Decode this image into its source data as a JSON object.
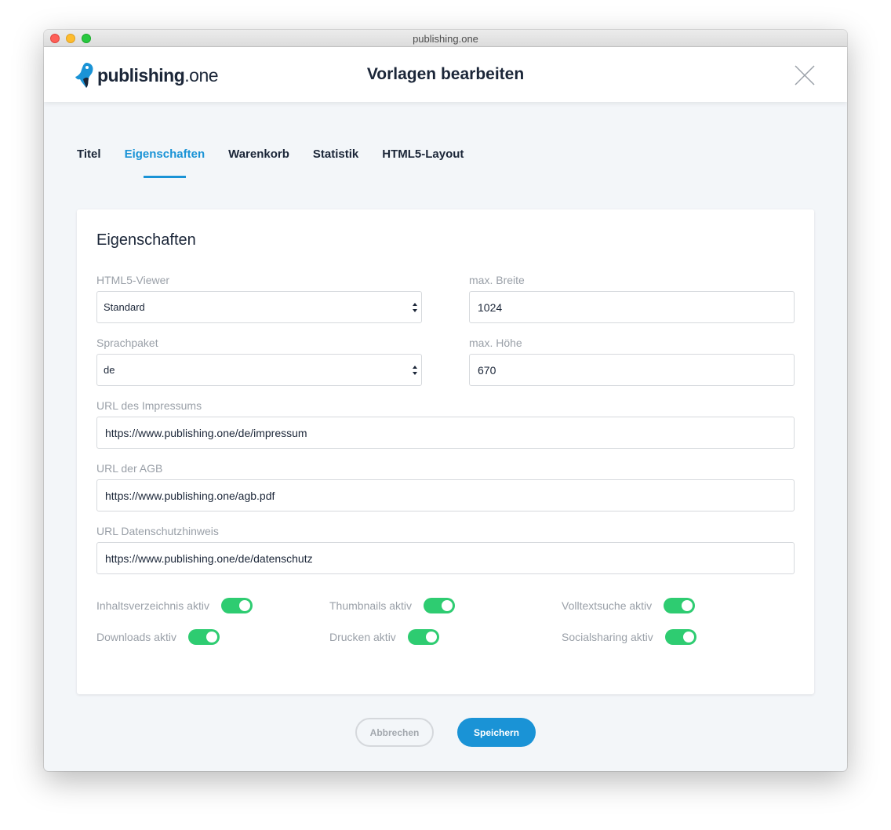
{
  "window": {
    "title": "publishing.one"
  },
  "header": {
    "logo_bold": "publishing",
    "logo_light": ".one",
    "title": "Vorlagen bearbeiten"
  },
  "tabs": [
    {
      "label": "Titel",
      "active": false
    },
    {
      "label": "Eigenschaften",
      "active": true
    },
    {
      "label": "Warenkorb",
      "active": false
    },
    {
      "label": "Statistik",
      "active": false
    },
    {
      "label": "HTML5-Layout",
      "active": false
    }
  ],
  "card": {
    "title": "Eigenschaften",
    "fields": {
      "viewer": {
        "label": "HTML5-Viewer",
        "value": "Standard"
      },
      "max_width": {
        "label": "max. Breite",
        "value": "1024"
      },
      "language": {
        "label": "Sprachpaket",
        "value": "de"
      },
      "max_height": {
        "label": "max. Höhe",
        "value": "670"
      },
      "imprint_url": {
        "label": "URL des Impressums",
        "value": "https://www.publishing.one/de/impressum"
      },
      "terms_url": {
        "label": "URL der AGB",
        "value": "https://www.publishing.one/agb.pdf"
      },
      "privacy_url": {
        "label": "URL Datenschutzhinweis",
        "value": "https://www.publishing.one/de/datenschutz"
      }
    },
    "toggles": [
      {
        "label": "Inhaltsverzeichnis aktiv",
        "on": true
      },
      {
        "label": "Thumbnails aktiv",
        "on": true
      },
      {
        "label": "Volltextsuche aktiv",
        "on": true
      },
      {
        "label": "Downloads aktiv",
        "on": true
      },
      {
        "label": "Drucken aktiv",
        "on": true
      },
      {
        "label": "Socialsharing aktiv",
        "on": true
      }
    ]
  },
  "actions": {
    "cancel": "Abbrechen",
    "save": "Speichern"
  },
  "colors": {
    "accent": "#1a93d6",
    "toggle_on": "#2ecc71",
    "heading": "#1b2638",
    "label": "#9aa0a8"
  },
  "icons": {
    "logo": "penguin-logo-icon",
    "close": "close-icon",
    "select_arrows": "select-arrows-icon"
  }
}
